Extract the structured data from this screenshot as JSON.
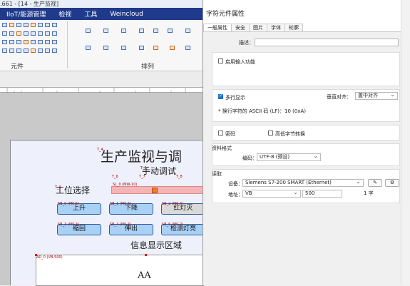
{
  "window": {
    "title": ".661 - [14 - 生产监视]"
  },
  "menu": [
    "IIoT/能源管理",
    "检视",
    "工具",
    "Weincloud"
  ],
  "ribbon": {
    "group_component": "元件",
    "group_arrange": "排列"
  },
  "screen": {
    "title": "生产监视与调",
    "manual": "手动调试",
    "station_select": "工位选择",
    "btn_up": "上升",
    "btn_down": "下降",
    "btn_light": "红灯灭",
    "btn_retract": "缩回",
    "btn_extend": "伸出",
    "btn_check": "检测灯亮",
    "info_area": "信息显示区域",
    "display_text": "AA",
    "addr_sl": "SL_0 (MW-10)",
    "addr_sb1": "SB_0 (M0.5)",
    "addr_sb2": "SB_1 (M0.6)",
    "addr_sb3": "SB_2 (M0.7)",
    "addr_sb4": "SB_3 (M0.3)",
    "addr_sb5": "SB_4 (M0.4)",
    "addr_sb6": "SB_5 (M0.2)",
    "addr_ad": "AD_0 (VB-500)",
    "addr_t4": "T_4",
    "addr_t5": "T_5",
    "addr_t6": "T_6",
    "addr_t7": "T_7",
    "addr_t8": "T_8",
    "addr_t9": "T_9"
  },
  "dialog": {
    "title": "字符元件属性",
    "tabs": [
      "一般属性",
      "安全",
      "图片",
      "字体",
      "轮廓"
    ],
    "desc_label": "描述：",
    "desc_value": "",
    "enable_input": "启用输入功能",
    "multiline": "多行显示",
    "vertical_align_label": "垂直对齐：",
    "vertical_align_value": "置中对齐",
    "newline_note": "* 换行字符的 ASCII 码 (LF)：10 (0xA)",
    "password": "密码",
    "high_low_swap": "高低字节转换",
    "data_format": "资料格式",
    "encoding_label": "编码：",
    "encoding_value": "UTF-8 (预设)",
    "read_section": "读取",
    "device_label": "设备：",
    "device_value": "Siemens S7-200 SMART (Ethernet)",
    "address_label": "地址：",
    "address_type": "VB",
    "address_value": "500",
    "length_value": "1 字"
  }
}
